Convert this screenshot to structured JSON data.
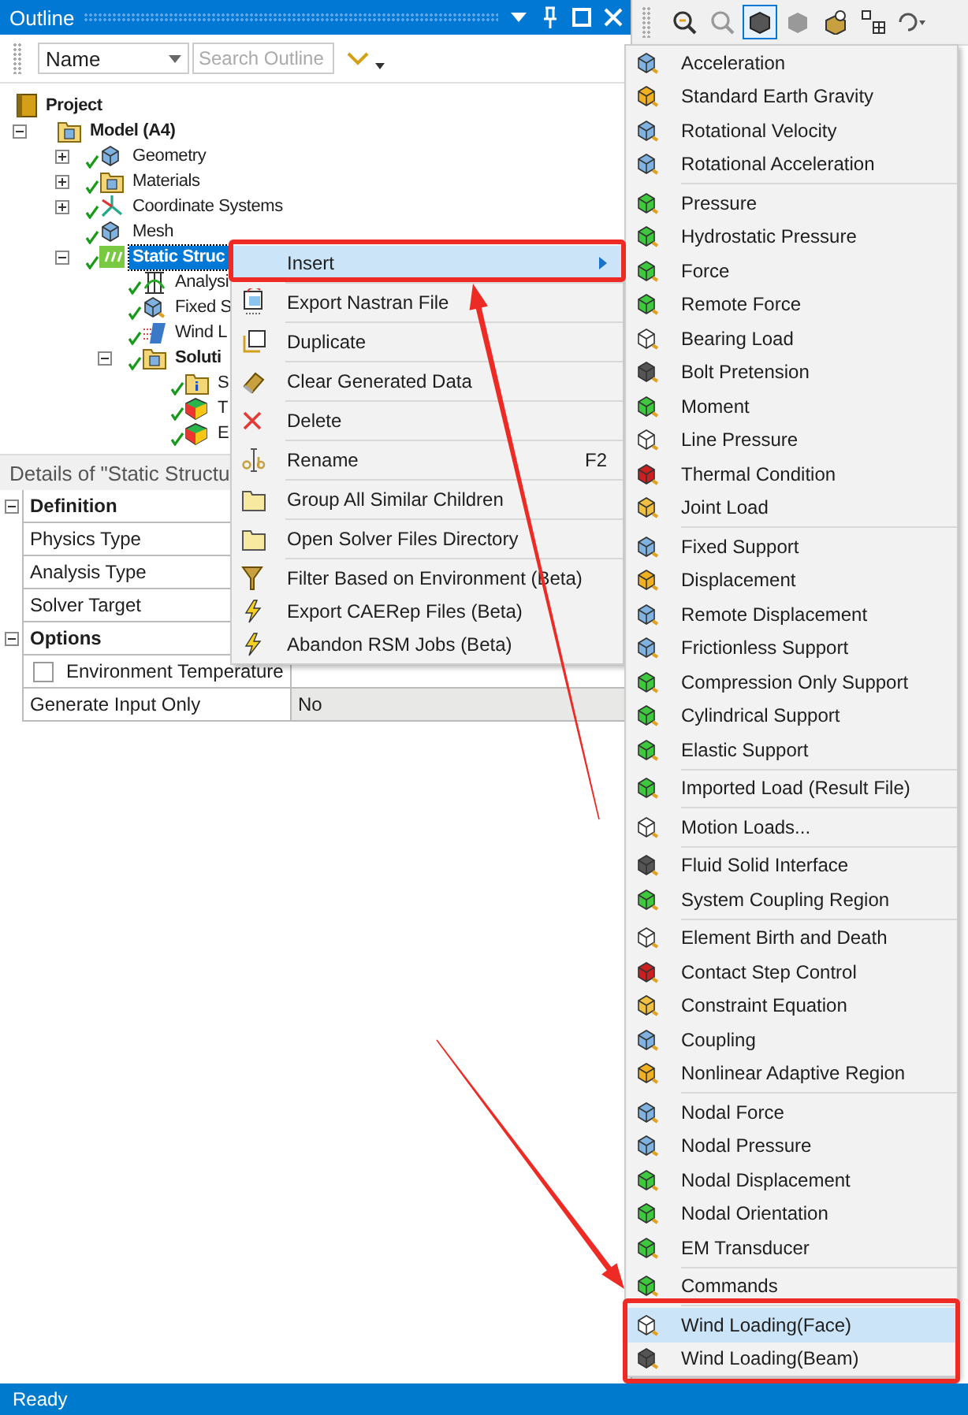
{
  "outline": {
    "title": "Outline",
    "filter": {
      "value": "Name"
    },
    "search": {
      "placeholder": "Search Outline"
    }
  },
  "tree": [
    {
      "label": "Project",
      "kind": "project",
      "bold": true,
      "done": false,
      "selected": false,
      "children": [
        {
          "label": "Model (A4)",
          "kind": "folder",
          "bold": true,
          "done": false,
          "expanded": true,
          "selected": false,
          "children": [
            {
              "label": "Geometry",
              "kind": "cube",
              "bold": false,
              "done": true,
              "expanded": false,
              "selected": false
            },
            {
              "label": "Materials",
              "kind": "folder",
              "bold": false,
              "done": true,
              "expanded": false,
              "selected": false
            },
            {
              "label": "Coordinate Systems",
              "kind": "axes",
              "bold": false,
              "done": true,
              "expanded": false,
              "selected": false
            },
            {
              "label": "Mesh",
              "kind": "cube",
              "bold": false,
              "done": true,
              "selected": false
            },
            {
              "label": "Static Struc",
              "kind": "static",
              "bold": true,
              "done": true,
              "expanded": true,
              "selected": true,
              "children": [
                {
                  "label": "Analysi",
                  "kind": "analysis",
                  "bold": false,
                  "done": true,
                  "selected": false
                },
                {
                  "label": "Fixed S",
                  "kind": "support",
                  "bold": false,
                  "done": true,
                  "selected": false
                },
                {
                  "label": "Wind L",
                  "kind": "wind",
                  "bold": false,
                  "done": true,
                  "selected": false
                },
                {
                  "label": "Soluti",
                  "kind": "folder",
                  "bold": true,
                  "done": true,
                  "expanded": true,
                  "selected": false,
                  "children": [
                    {
                      "label": "S",
                      "kind": "info",
                      "bold": false,
                      "done": true,
                      "selected": false
                    },
                    {
                      "label": "T",
                      "kind": "result",
                      "bold": false,
                      "done": true,
                      "selected": false
                    },
                    {
                      "label": "E",
                      "kind": "result",
                      "bold": false,
                      "done": true,
                      "selected": false
                    }
                  ]
                }
              ]
            }
          ]
        }
      ]
    }
  ],
  "details": {
    "title": "Details of \"Static Structu",
    "rows": [
      {
        "kind": "group",
        "label": "Definition",
        "expanded": true
      },
      {
        "kind": "property",
        "label": "Physics Type"
      },
      {
        "kind": "property",
        "label": "Analysis Type"
      },
      {
        "kind": "property",
        "label": "Solver Target"
      },
      {
        "kind": "group",
        "label": "Options",
        "expanded": true
      },
      {
        "kind": "checkbox",
        "label": "Environment Temperature",
        "checked": false
      },
      {
        "kind": "property",
        "label": "Generate Input Only",
        "value": "No"
      }
    ]
  },
  "graphics_toolbar": {
    "buttons": [
      {
        "selected": false
      },
      {
        "selected": false
      },
      {
        "selected": true
      },
      {
        "selected": false
      },
      {
        "selected": false
      },
      {
        "selected": false
      },
      {
        "selected": false
      }
    ]
  },
  "context_menu": {
    "groups": [
      [
        {
          "label": "Insert",
          "kind": "submenu",
          "selected": true
        }
      ],
      [
        {
          "label": "Export Nastran File",
          "kind": "export",
          "selected": false
        }
      ],
      [
        {
          "label": "Duplicate",
          "kind": "duplicate",
          "selected": false
        }
      ],
      [
        {
          "label": "Clear Generated Data",
          "kind": "eraser",
          "selected": false
        }
      ],
      [
        {
          "label": "Delete",
          "kind": "delete",
          "selected": false
        }
      ],
      [
        {
          "label": "Rename",
          "kind": "rename",
          "shortcut": "F2",
          "selected": false
        }
      ],
      [
        {
          "label": "Group All Similar Children",
          "kind": "folder",
          "selected": false
        }
      ],
      [
        {
          "label": "Open Solver Files Directory",
          "kind": "folder",
          "selected": false
        }
      ],
      [
        {
          "label": "Filter Based on Environment (Beta)",
          "kind": "filter",
          "selected": false
        },
        {
          "label": "Export CAERep Files (Beta)",
          "kind": "bolt",
          "selected": false
        },
        {
          "label": "Abandon RSM Jobs (Beta)",
          "kind": "bolt",
          "selected": false
        }
      ]
    ]
  },
  "submenu": {
    "groups": [
      [
        {
          "label": "Acceleration",
          "selected": false
        },
        {
          "label": "Standard Earth Gravity",
          "selected": false
        },
        {
          "label": "Rotational Velocity",
          "selected": false
        },
        {
          "label": "Rotational Acceleration",
          "selected": false
        }
      ],
      [
        {
          "label": "Pressure",
          "selected": false
        },
        {
          "label": "Hydrostatic Pressure",
          "selected": false
        },
        {
          "label": "Force",
          "selected": false
        },
        {
          "label": "Remote Force",
          "selected": false
        },
        {
          "label": "Bearing Load",
          "selected": false
        },
        {
          "label": "Bolt Pretension",
          "selected": false
        },
        {
          "label": "Moment",
          "selected": false
        },
        {
          "label": "Line Pressure",
          "selected": false
        },
        {
          "label": "Thermal Condition",
          "selected": false
        },
        {
          "label": "Joint Load",
          "selected": false
        }
      ],
      [
        {
          "label": "Fixed Support",
          "selected": false
        },
        {
          "label": "Displacement",
          "selected": false
        },
        {
          "label": "Remote Displacement",
          "selected": false
        },
        {
          "label": "Frictionless Support",
          "selected": false
        },
        {
          "label": "Compression Only Support",
          "selected": false
        },
        {
          "label": "Cylindrical Support",
          "selected": false
        },
        {
          "label": "Elastic Support",
          "selected": false
        }
      ],
      [
        {
          "label": "Imported Load (Result File)",
          "selected": false
        }
      ],
      [
        {
          "label": "Motion Loads...",
          "selected": false
        }
      ],
      [
        {
          "label": "Fluid Solid Interface",
          "selected": false
        },
        {
          "label": "System Coupling Region",
          "selected": false
        }
      ],
      [
        {
          "label": "Element Birth and Death",
          "selected": false
        },
        {
          "label": "Contact Step Control",
          "selected": false
        },
        {
          "label": "Constraint Equation",
          "selected": false
        },
        {
          "label": "Coupling",
          "selected": false
        },
        {
          "label": "Nonlinear Adaptive Region",
          "selected": false
        }
      ],
      [
        {
          "label": "Nodal Force",
          "selected": false
        },
        {
          "label": "Nodal Pressure",
          "selected": false
        },
        {
          "label": "Nodal Displacement",
          "selected": false
        },
        {
          "label": "Nodal Orientation",
          "selected": false
        },
        {
          "label": "EM Transducer",
          "selected": false
        }
      ],
      [
        {
          "label": "Commands",
          "selected": false
        }
      ],
      [
        {
          "label": "Wind Loading(Face)",
          "selected": true
        },
        {
          "label": "Wind Loading(Beam)",
          "selected": false
        }
      ]
    ]
  },
  "status_bar": {
    "text": "Ready"
  }
}
